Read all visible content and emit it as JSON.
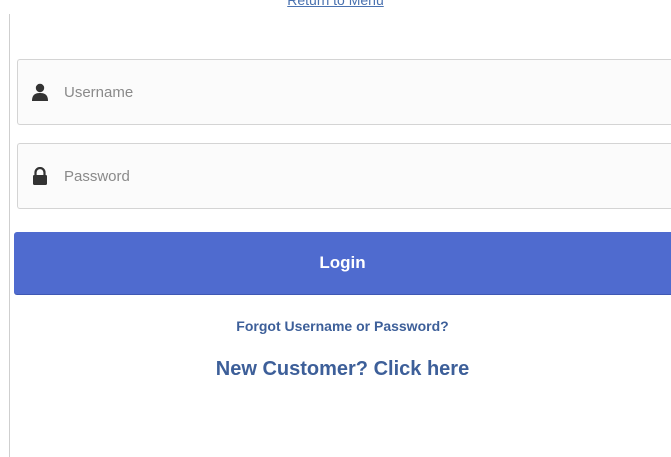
{
  "header": {
    "return_link": "Return to Menu"
  },
  "login_form": {
    "username": {
      "placeholder": "Username",
      "value": "",
      "icon": "user-icon"
    },
    "password": {
      "placeholder": "Password",
      "value": "",
      "icon": "lock-icon"
    },
    "login_label": "Login",
    "forgot_link": "Forgot Username or Password?",
    "new_customer_link": "New Customer? Click here"
  },
  "colors": {
    "login_button": "#4f6bcf",
    "link": "#3d5f99",
    "field_border": "#d4d4d4"
  }
}
